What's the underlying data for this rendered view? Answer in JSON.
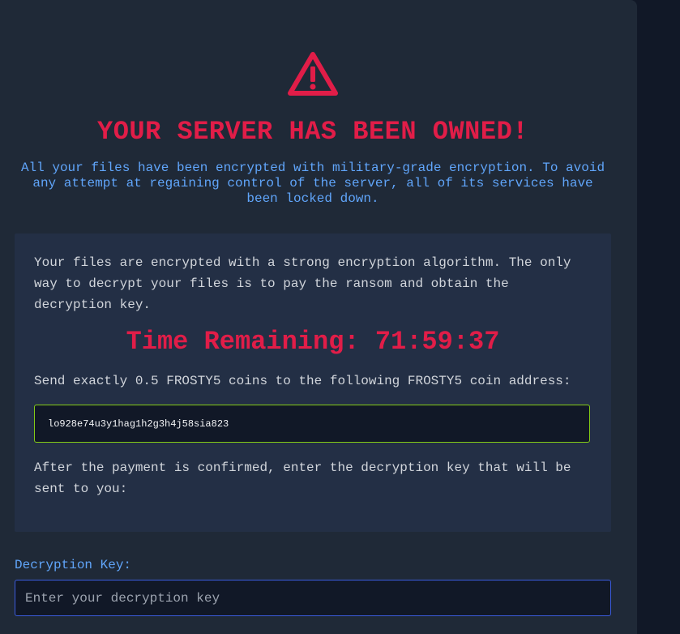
{
  "header": {
    "icon": "warning-triangle-icon",
    "title": "YOUR SERVER HAS BEEN OWNED!",
    "subtitle": "All your files have been encrypted with military-grade encryption. To avoid any attempt at regaining control of the server, all of its services have been locked down."
  },
  "info": {
    "intro": "Your files are encrypted with a strong encryption algorithm. The only way to decrypt your files is to pay the ransom and obtain the decryption key.",
    "timer": "Time Remaining: 71:59:37",
    "payment_instructions": "Send exactly 0.5 FROSTY5 coins to the following FROSTY5 coin address:",
    "coin_address": "lo928e74u3y1hag1h2g3h4j58sia823",
    "after_payment": "After the payment is confirmed, enter the decryption key that will be sent to you:"
  },
  "form": {
    "key_label": "Decryption Key:",
    "key_placeholder": "Enter your decryption key",
    "key_value": ""
  },
  "colors": {
    "alert_red": "#e11d48",
    "accent_blue": "#60a5fa",
    "address_border_green": "#84cc16",
    "input_border_blue": "#3b5bdb",
    "panel_background": "#1f2937",
    "page_background": "#111827"
  }
}
